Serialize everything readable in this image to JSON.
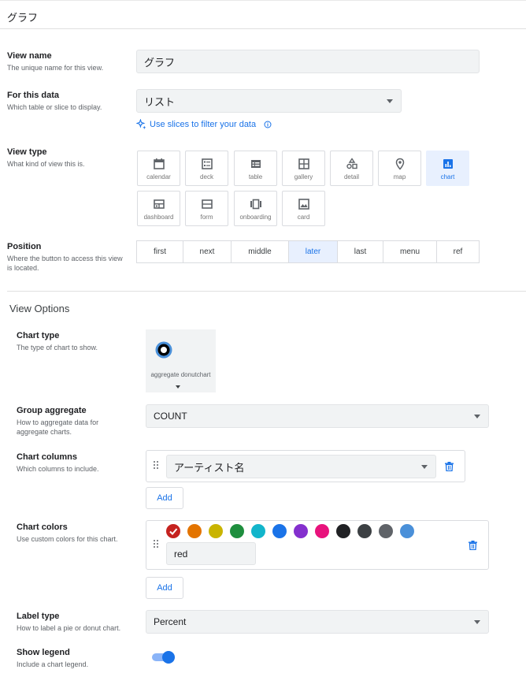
{
  "header": {
    "title": "グラフ"
  },
  "view_name": {
    "label": "View name",
    "desc": "The unique name for this view.",
    "value": "グラフ"
  },
  "for_data": {
    "label": "For this data",
    "desc": "Which table or slice to display.",
    "value": "リスト",
    "link": "Use slices to filter your data"
  },
  "view_type": {
    "label": "View type",
    "desc": "What kind of view this is.",
    "options": [
      "calendar",
      "deck",
      "table",
      "gallery",
      "detail",
      "map",
      "chart",
      "dashboard",
      "form",
      "onboarding",
      "card"
    ],
    "selected": "chart"
  },
  "position": {
    "label": "Position",
    "desc": "Where the button to access this view is located.",
    "options": [
      "first",
      "next",
      "middle",
      "later",
      "last",
      "menu",
      "ref"
    ],
    "selected": "later"
  },
  "view_options": {
    "heading": "View Options"
  },
  "chart_type": {
    "label": "Chart type",
    "desc": "The type of chart to show.",
    "value": "aggregate donutchart"
  },
  "group_aggregate": {
    "label": "Group aggregate",
    "desc": "How to aggregate data for aggregate charts.",
    "value": "COUNT"
  },
  "chart_columns": {
    "label": "Chart columns",
    "desc": "Which columns to include.",
    "value": "アーティスト名",
    "add": "Add"
  },
  "chart_colors": {
    "label": "Chart colors",
    "desc": "Use custom colors for this chart.",
    "value": "red",
    "add": "Add",
    "swatches": [
      "#c5221f",
      "#e37400",
      "#c9b400",
      "#1e8e3e",
      "#12b5cb",
      "#1a73e8",
      "#8430ce",
      "#e8127c",
      "#202124",
      "#3c4043",
      "#5f6368",
      "#4a90d9"
    ],
    "selected_index": 0
  },
  "label_type": {
    "label": "Label type",
    "desc": "How to label a pie or donut chart.",
    "value": "Percent"
  },
  "show_legend": {
    "label": "Show legend",
    "desc": "Include a chart legend.",
    "on": true
  }
}
